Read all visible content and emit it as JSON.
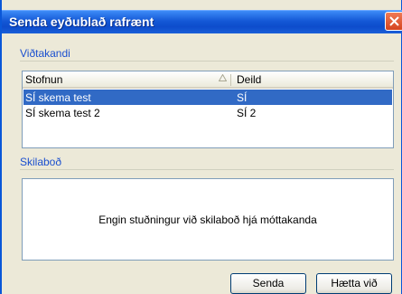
{
  "window": {
    "title": "Senda eyðublað rafrænt"
  },
  "recipients": {
    "group_label": "Viðtakandi",
    "columns": {
      "stofnun": "Stofnun",
      "deild": "Deild"
    },
    "rows": [
      {
        "stofnun": "SÍ skema test",
        "deild": "SÍ",
        "selected": true
      },
      {
        "stofnun": "SÍ skema test 2",
        "deild": "SÍ 2",
        "selected": false
      }
    ]
  },
  "message": {
    "group_label": "Skilaboð",
    "text": "Engin stuðningur við skilaboð hjá móttakanda"
  },
  "buttons": {
    "send": "Senda",
    "cancel": "Hætta við"
  },
  "colors": {
    "title_bar": "#1458d6",
    "selection": "#316ac5",
    "group_label": "#1a4fcf"
  },
  "icons": {
    "close": "close-icon",
    "sort": "sort-ascending-icon"
  }
}
